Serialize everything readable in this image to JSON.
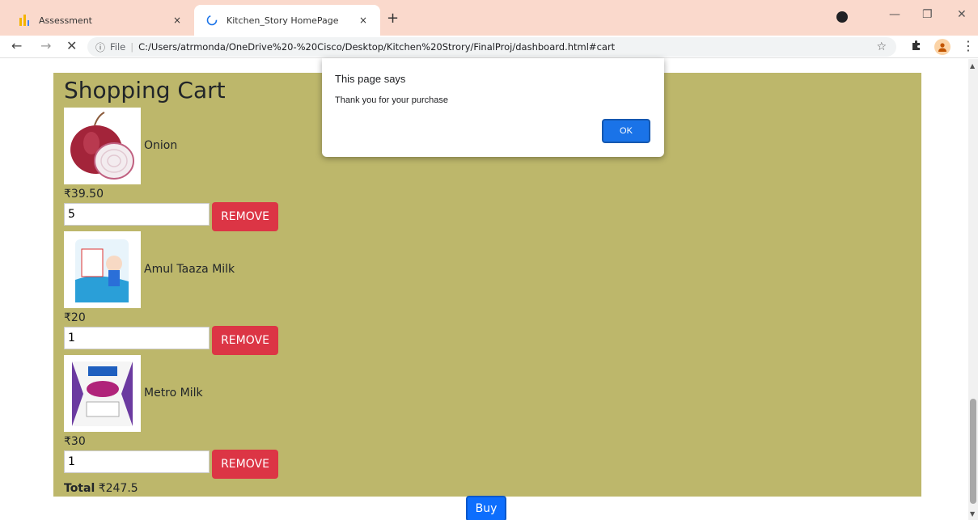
{
  "browser": {
    "tabs": [
      {
        "title": "Assessment",
        "close": "×",
        "favicon": "bar-chart-icon"
      },
      {
        "title": "Kitchen_Story HomePage",
        "close": "×",
        "favicon": "loading-spinner-icon"
      }
    ],
    "new_tab": "+",
    "window_controls": {
      "minimize": "—",
      "restore": "❐",
      "close": "✕"
    },
    "nav": {
      "back": "←",
      "forward": "→",
      "stop": "✕"
    },
    "address": {
      "info": "ⓘ",
      "scheme": "File",
      "separator": "|",
      "url": "C:/Users/atrmonda/OneDrive%20-%20Cisco/Desktop/Kitchen%20Strory/FinalProj/dashboard.html#cart",
      "star": "☆"
    },
    "menu": "⋮"
  },
  "cart": {
    "heading": "Shopping Cart",
    "items": [
      {
        "name": "Onion",
        "price": "₹39.50",
        "qty": "5",
        "remove_label": "REMOVE"
      },
      {
        "name": "Amul Taaza Milk",
        "price": "₹20",
        "qty": "1",
        "remove_label": "REMOVE"
      },
      {
        "name": "Metro Milk",
        "price": "₹30",
        "qty": "1",
        "remove_label": "REMOVE"
      }
    ],
    "total_label": "Total",
    "total_value": "₹247.5",
    "buy_label": "Buy"
  },
  "dialog": {
    "title": "This page says",
    "message": "Thank you for your purchase",
    "ok_label": "OK"
  },
  "colors": {
    "cart_bg": "#bdb76b",
    "remove": "#dc3545",
    "buy": "#0d6efd",
    "tabstrip": "#fad9cc"
  }
}
